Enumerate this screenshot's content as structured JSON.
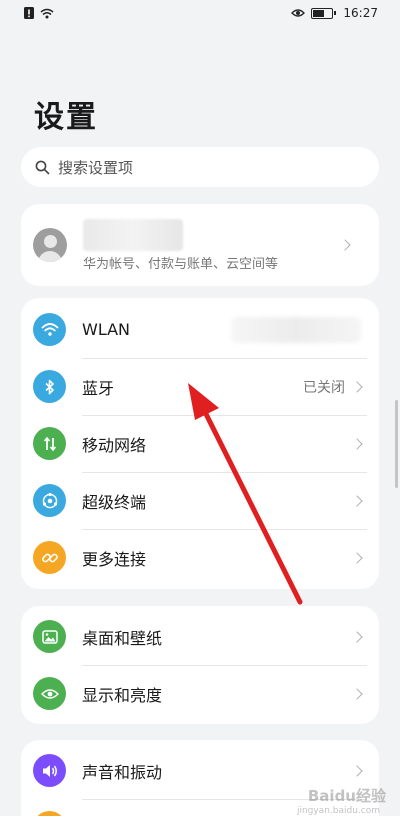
{
  "status_bar": {
    "time": "16:27",
    "icons": [
      "alert-icon",
      "wifi-icon",
      "eye-icon",
      "battery-icon"
    ]
  },
  "page": {
    "title": "设置"
  },
  "search": {
    "placeholder": "搜索设置项"
  },
  "account": {
    "subtitle": "华为帐号、付款与账单、云空间等"
  },
  "connectivity": [
    {
      "label": "WLAN",
      "icon": "wifi-icon",
      "color": "#3aa9e0",
      "value": ""
    },
    {
      "label": "蓝牙",
      "icon": "bluetooth-icon",
      "color": "#3aa9e0",
      "value": "已关闭"
    },
    {
      "label": "移动网络",
      "icon": "mobile-data-icon",
      "color": "#4caf50",
      "value": ""
    },
    {
      "label": "超级终端",
      "icon": "super-device-icon",
      "color": "#3aa9e0",
      "value": ""
    },
    {
      "label": "更多连接",
      "icon": "link-icon",
      "color": "#f5a623",
      "value": ""
    }
  ],
  "display": [
    {
      "label": "桌面和壁纸",
      "icon": "wallpaper-icon",
      "color": "#4caf50"
    },
    {
      "label": "显示和亮度",
      "icon": "eye-icon",
      "color": "#4caf50"
    }
  ],
  "sound": [
    {
      "label": "声音和振动",
      "icon": "speaker-icon",
      "color": "#7c4dff"
    }
  ],
  "watermark": {
    "text": "Baidu经验",
    "sub": "jingyan.baidu.com"
  }
}
